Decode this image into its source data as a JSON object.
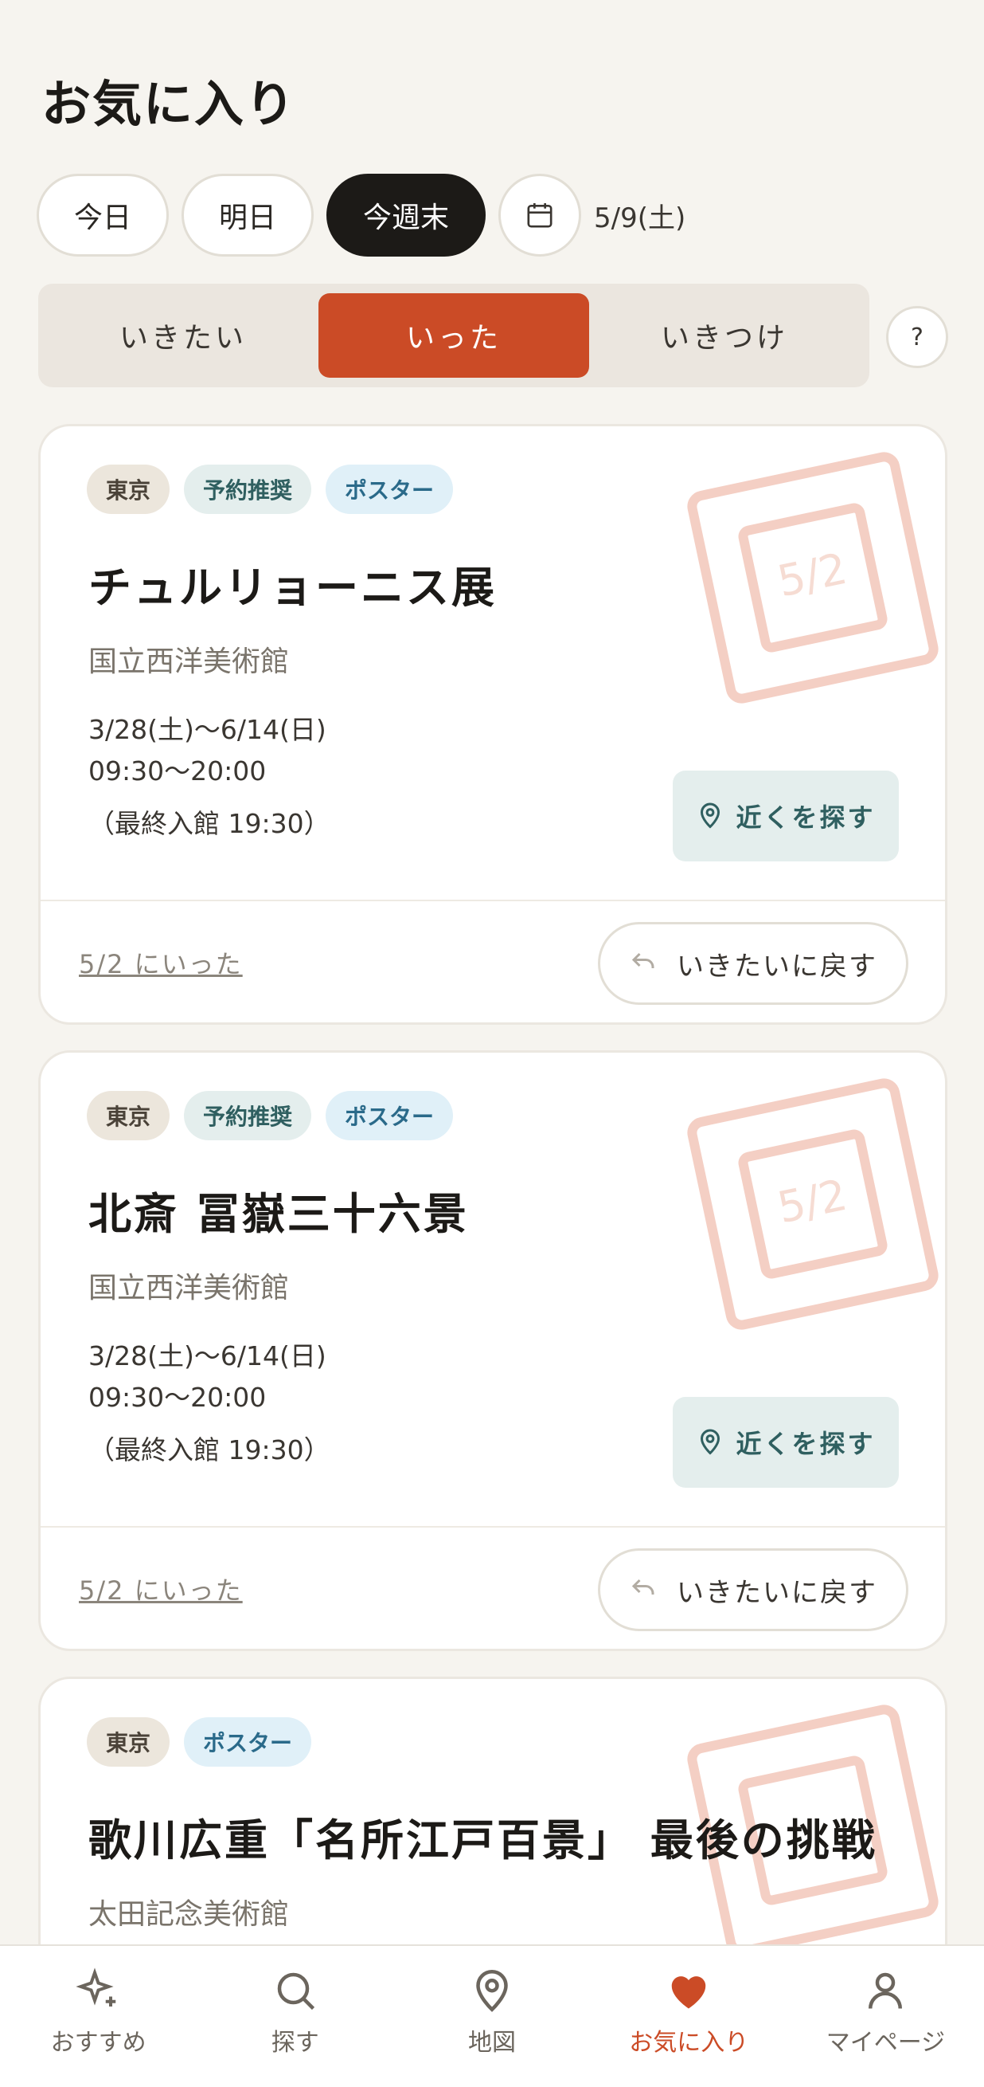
{
  "header": {
    "title": "お気に入り"
  },
  "date_filter": {
    "today": "今日",
    "tomorrow": "明日",
    "weekend": "今週末",
    "selected_date": "5/9(土)"
  },
  "tabs": {
    "want": "いきたい",
    "went": "いった",
    "regular": "いきつけ",
    "help": "?"
  },
  "cards": [
    {
      "tags": [
        "東京",
        "予約推奨",
        "ポスター"
      ],
      "title": "チュルリョーニス展",
      "venue": "国立西洋美術館",
      "period": "3/28(土)〜6/14(日)",
      "hours": "09:30〜20:00",
      "last_entry": "（最終入館 19:30）",
      "near_button": "近くを探す",
      "visited_text": "5/2 にいった",
      "back_button": "いきたいに戻す",
      "stamp": "5/2"
    },
    {
      "tags": [
        "東京",
        "予約推奨",
        "ポスター"
      ],
      "title": "北斎 冨嶽三十六景",
      "venue": "国立西洋美術館",
      "period": "3/28(土)〜6/14(日)",
      "hours": "09:30〜20:00",
      "last_entry": "（最終入館 19:30）",
      "near_button": "近くを探す",
      "visited_text": "5/2 にいった",
      "back_button": "いきたいに戻す",
      "stamp": "5/2"
    },
    {
      "tags": [
        "東京",
        "ポスター"
      ],
      "title": "歌川広重「名所江戸百景」 最後の挑戦",
      "venue": "太田記念美術館"
    }
  ],
  "bottom_nav": {
    "items": [
      {
        "label": "おすすめ",
        "icon": "sparkle-icon"
      },
      {
        "label": "探す",
        "icon": "search-icon"
      },
      {
        "label": "地図",
        "icon": "map-pin-icon"
      },
      {
        "label": "お気に入り",
        "icon": "heart-icon"
      },
      {
        "label": "マイページ",
        "icon": "user-icon"
      }
    ]
  },
  "colors": {
    "accent": "#cb4b26",
    "teal": "#2f5f60",
    "background": "#f6f4ef"
  }
}
